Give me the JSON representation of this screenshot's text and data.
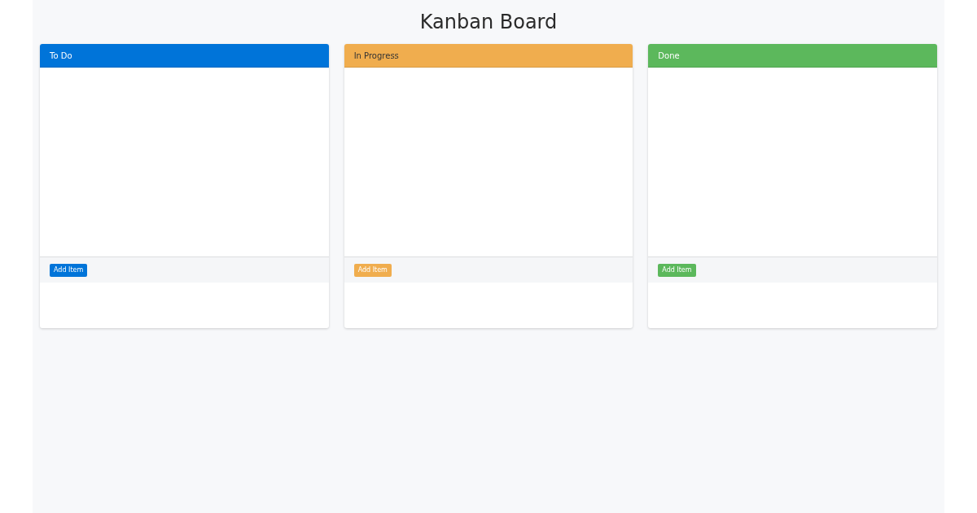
{
  "title": "Kanban Board",
  "columns": [
    {
      "name": "To Do",
      "color": "#0074d9",
      "button": "Add Item"
    },
    {
      "name": "In Progress",
      "color": "#f0ad4e",
      "button": "Add Item"
    },
    {
      "name": "Done",
      "color": "#5cb85c",
      "button": "Add Item"
    }
  ]
}
